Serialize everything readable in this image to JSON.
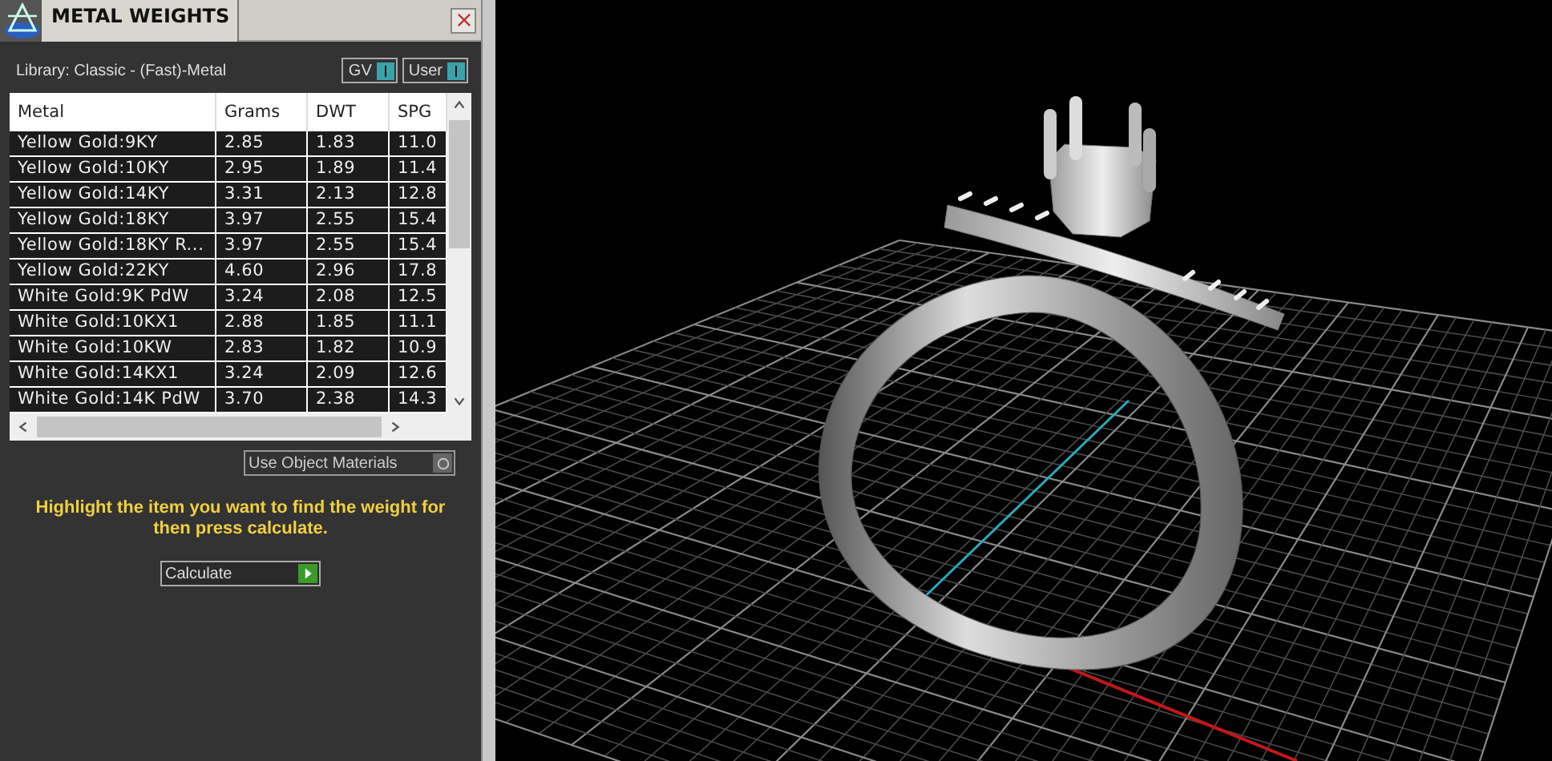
{
  "panel": {
    "title": "METAL WEIGHTS",
    "library": "Library: Classic - (Fast)-Metal",
    "toggles": [
      {
        "label": "GV",
        "on": true
      },
      {
        "label": "User",
        "on": true
      }
    ],
    "table": {
      "columns": [
        "Metal",
        "Grams",
        "DWT",
        "SPG"
      ],
      "rows": [
        [
          "Yellow Gold:9KY",
          "2.85",
          "1.83",
          "11.0"
        ],
        [
          "Yellow Gold:10KY",
          "2.95",
          "1.89",
          "11.4"
        ],
        [
          "Yellow Gold:14KY",
          "3.31",
          "2.13",
          "12.8"
        ],
        [
          "Yellow Gold:18KY",
          "3.97",
          "2.55",
          "15.4"
        ],
        [
          "Yellow Gold:18KY R...",
          "3.97",
          "2.55",
          "15.4"
        ],
        [
          "Yellow Gold:22KY",
          "4.60",
          "2.96",
          "17.8"
        ],
        [
          "White Gold:9K PdW",
          "3.24",
          "2.08",
          "12.5"
        ],
        [
          "White Gold:10KX1",
          "2.88",
          "1.85",
          "11.1"
        ],
        [
          "White Gold:10KW",
          "2.83",
          "1.82",
          "10.9"
        ],
        [
          "White Gold:14KX1",
          "3.24",
          "2.09",
          "12.6"
        ],
        [
          "White Gold:14K PdW",
          "3.70",
          "2.38",
          "14.3"
        ]
      ]
    },
    "use_object_materials": {
      "label": "Use Object Materials",
      "on": false
    },
    "hint": "Highlight the item you want to find the weight for then press calculate.",
    "calculate_button": "Calculate"
  }
}
